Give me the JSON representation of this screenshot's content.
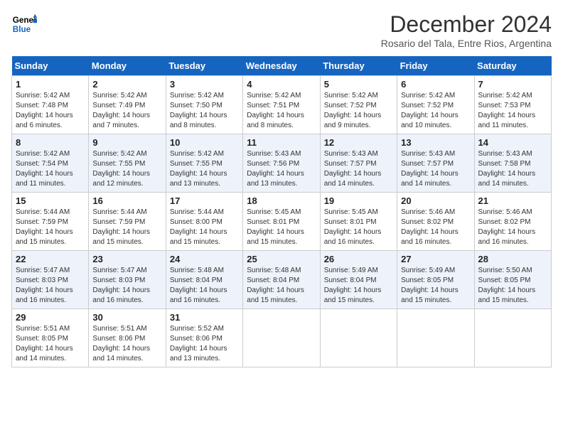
{
  "header": {
    "logo_line1": "General",
    "logo_line2": "Blue",
    "month_title": "December 2024",
    "location": "Rosario del Tala, Entre Rios, Argentina"
  },
  "days_of_week": [
    "Sunday",
    "Monday",
    "Tuesday",
    "Wednesday",
    "Thursday",
    "Friday",
    "Saturday"
  ],
  "weeks": [
    [
      {
        "day": "1",
        "sunrise": "5:42 AM",
        "sunset": "7:48 PM",
        "daylight": "14 hours and 6 minutes."
      },
      {
        "day": "2",
        "sunrise": "5:42 AM",
        "sunset": "7:49 PM",
        "daylight": "14 hours and 7 minutes."
      },
      {
        "day": "3",
        "sunrise": "5:42 AM",
        "sunset": "7:50 PM",
        "daylight": "14 hours and 8 minutes."
      },
      {
        "day": "4",
        "sunrise": "5:42 AM",
        "sunset": "7:51 PM",
        "daylight": "14 hours and 8 minutes."
      },
      {
        "day": "5",
        "sunrise": "5:42 AM",
        "sunset": "7:52 PM",
        "daylight": "14 hours and 9 minutes."
      },
      {
        "day": "6",
        "sunrise": "5:42 AM",
        "sunset": "7:52 PM",
        "daylight": "14 hours and 10 minutes."
      },
      {
        "day": "7",
        "sunrise": "5:42 AM",
        "sunset": "7:53 PM",
        "daylight": "14 hours and 11 minutes."
      }
    ],
    [
      {
        "day": "8",
        "sunrise": "5:42 AM",
        "sunset": "7:54 PM",
        "daylight": "14 hours and 11 minutes."
      },
      {
        "day": "9",
        "sunrise": "5:42 AM",
        "sunset": "7:55 PM",
        "daylight": "14 hours and 12 minutes."
      },
      {
        "day": "10",
        "sunrise": "5:42 AM",
        "sunset": "7:55 PM",
        "daylight": "14 hours and 13 minutes."
      },
      {
        "day": "11",
        "sunrise": "5:43 AM",
        "sunset": "7:56 PM",
        "daylight": "14 hours and 13 minutes."
      },
      {
        "day": "12",
        "sunrise": "5:43 AM",
        "sunset": "7:57 PM",
        "daylight": "14 hours and 14 minutes."
      },
      {
        "day": "13",
        "sunrise": "5:43 AM",
        "sunset": "7:57 PM",
        "daylight": "14 hours and 14 minutes."
      },
      {
        "day": "14",
        "sunrise": "5:43 AM",
        "sunset": "7:58 PM",
        "daylight": "14 hours and 14 minutes."
      }
    ],
    [
      {
        "day": "15",
        "sunrise": "5:44 AM",
        "sunset": "7:59 PM",
        "daylight": "14 hours and 15 minutes."
      },
      {
        "day": "16",
        "sunrise": "5:44 AM",
        "sunset": "7:59 PM",
        "daylight": "14 hours and 15 minutes."
      },
      {
        "day": "17",
        "sunrise": "5:44 AM",
        "sunset": "8:00 PM",
        "daylight": "14 hours and 15 minutes."
      },
      {
        "day": "18",
        "sunrise": "5:45 AM",
        "sunset": "8:01 PM",
        "daylight": "14 hours and 15 minutes."
      },
      {
        "day": "19",
        "sunrise": "5:45 AM",
        "sunset": "8:01 PM",
        "daylight": "14 hours and 16 minutes."
      },
      {
        "day": "20",
        "sunrise": "5:46 AM",
        "sunset": "8:02 PM",
        "daylight": "14 hours and 16 minutes."
      },
      {
        "day": "21",
        "sunrise": "5:46 AM",
        "sunset": "8:02 PM",
        "daylight": "14 hours and 16 minutes."
      }
    ],
    [
      {
        "day": "22",
        "sunrise": "5:47 AM",
        "sunset": "8:03 PM",
        "daylight": "14 hours and 16 minutes."
      },
      {
        "day": "23",
        "sunrise": "5:47 AM",
        "sunset": "8:03 PM",
        "daylight": "14 hours and 16 minutes."
      },
      {
        "day": "24",
        "sunrise": "5:48 AM",
        "sunset": "8:04 PM",
        "daylight": "14 hours and 16 minutes."
      },
      {
        "day": "25",
        "sunrise": "5:48 AM",
        "sunset": "8:04 PM",
        "daylight": "14 hours and 15 minutes."
      },
      {
        "day": "26",
        "sunrise": "5:49 AM",
        "sunset": "8:04 PM",
        "daylight": "14 hours and 15 minutes."
      },
      {
        "day": "27",
        "sunrise": "5:49 AM",
        "sunset": "8:05 PM",
        "daylight": "14 hours and 15 minutes."
      },
      {
        "day": "28",
        "sunrise": "5:50 AM",
        "sunset": "8:05 PM",
        "daylight": "14 hours and 15 minutes."
      }
    ],
    [
      {
        "day": "29",
        "sunrise": "5:51 AM",
        "sunset": "8:05 PM",
        "daylight": "14 hours and 14 minutes."
      },
      {
        "day": "30",
        "sunrise": "5:51 AM",
        "sunset": "8:06 PM",
        "daylight": "14 hours and 14 minutes."
      },
      {
        "day": "31",
        "sunrise": "5:52 AM",
        "sunset": "8:06 PM",
        "daylight": "14 hours and 13 minutes."
      },
      null,
      null,
      null,
      null
    ]
  ]
}
